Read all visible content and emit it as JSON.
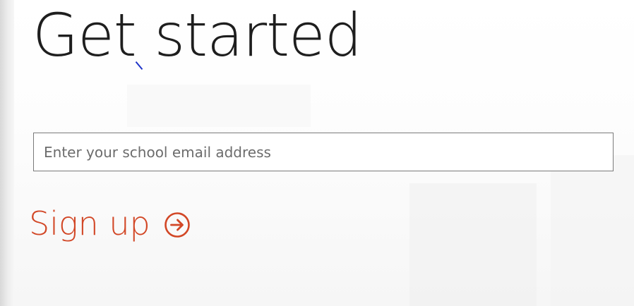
{
  "page": {
    "title": "Get started"
  },
  "form": {
    "email_placeholder": "Enter your school email address",
    "email_value": ""
  },
  "actions": {
    "signup_label": "Sign up",
    "signup_icon": "circle-arrow-right-icon"
  },
  "colors": {
    "accent": "#d24726",
    "title_text": "#1e1e1e",
    "input_border": "#7a7a7a",
    "cursor_mark": "#1e33c8"
  }
}
